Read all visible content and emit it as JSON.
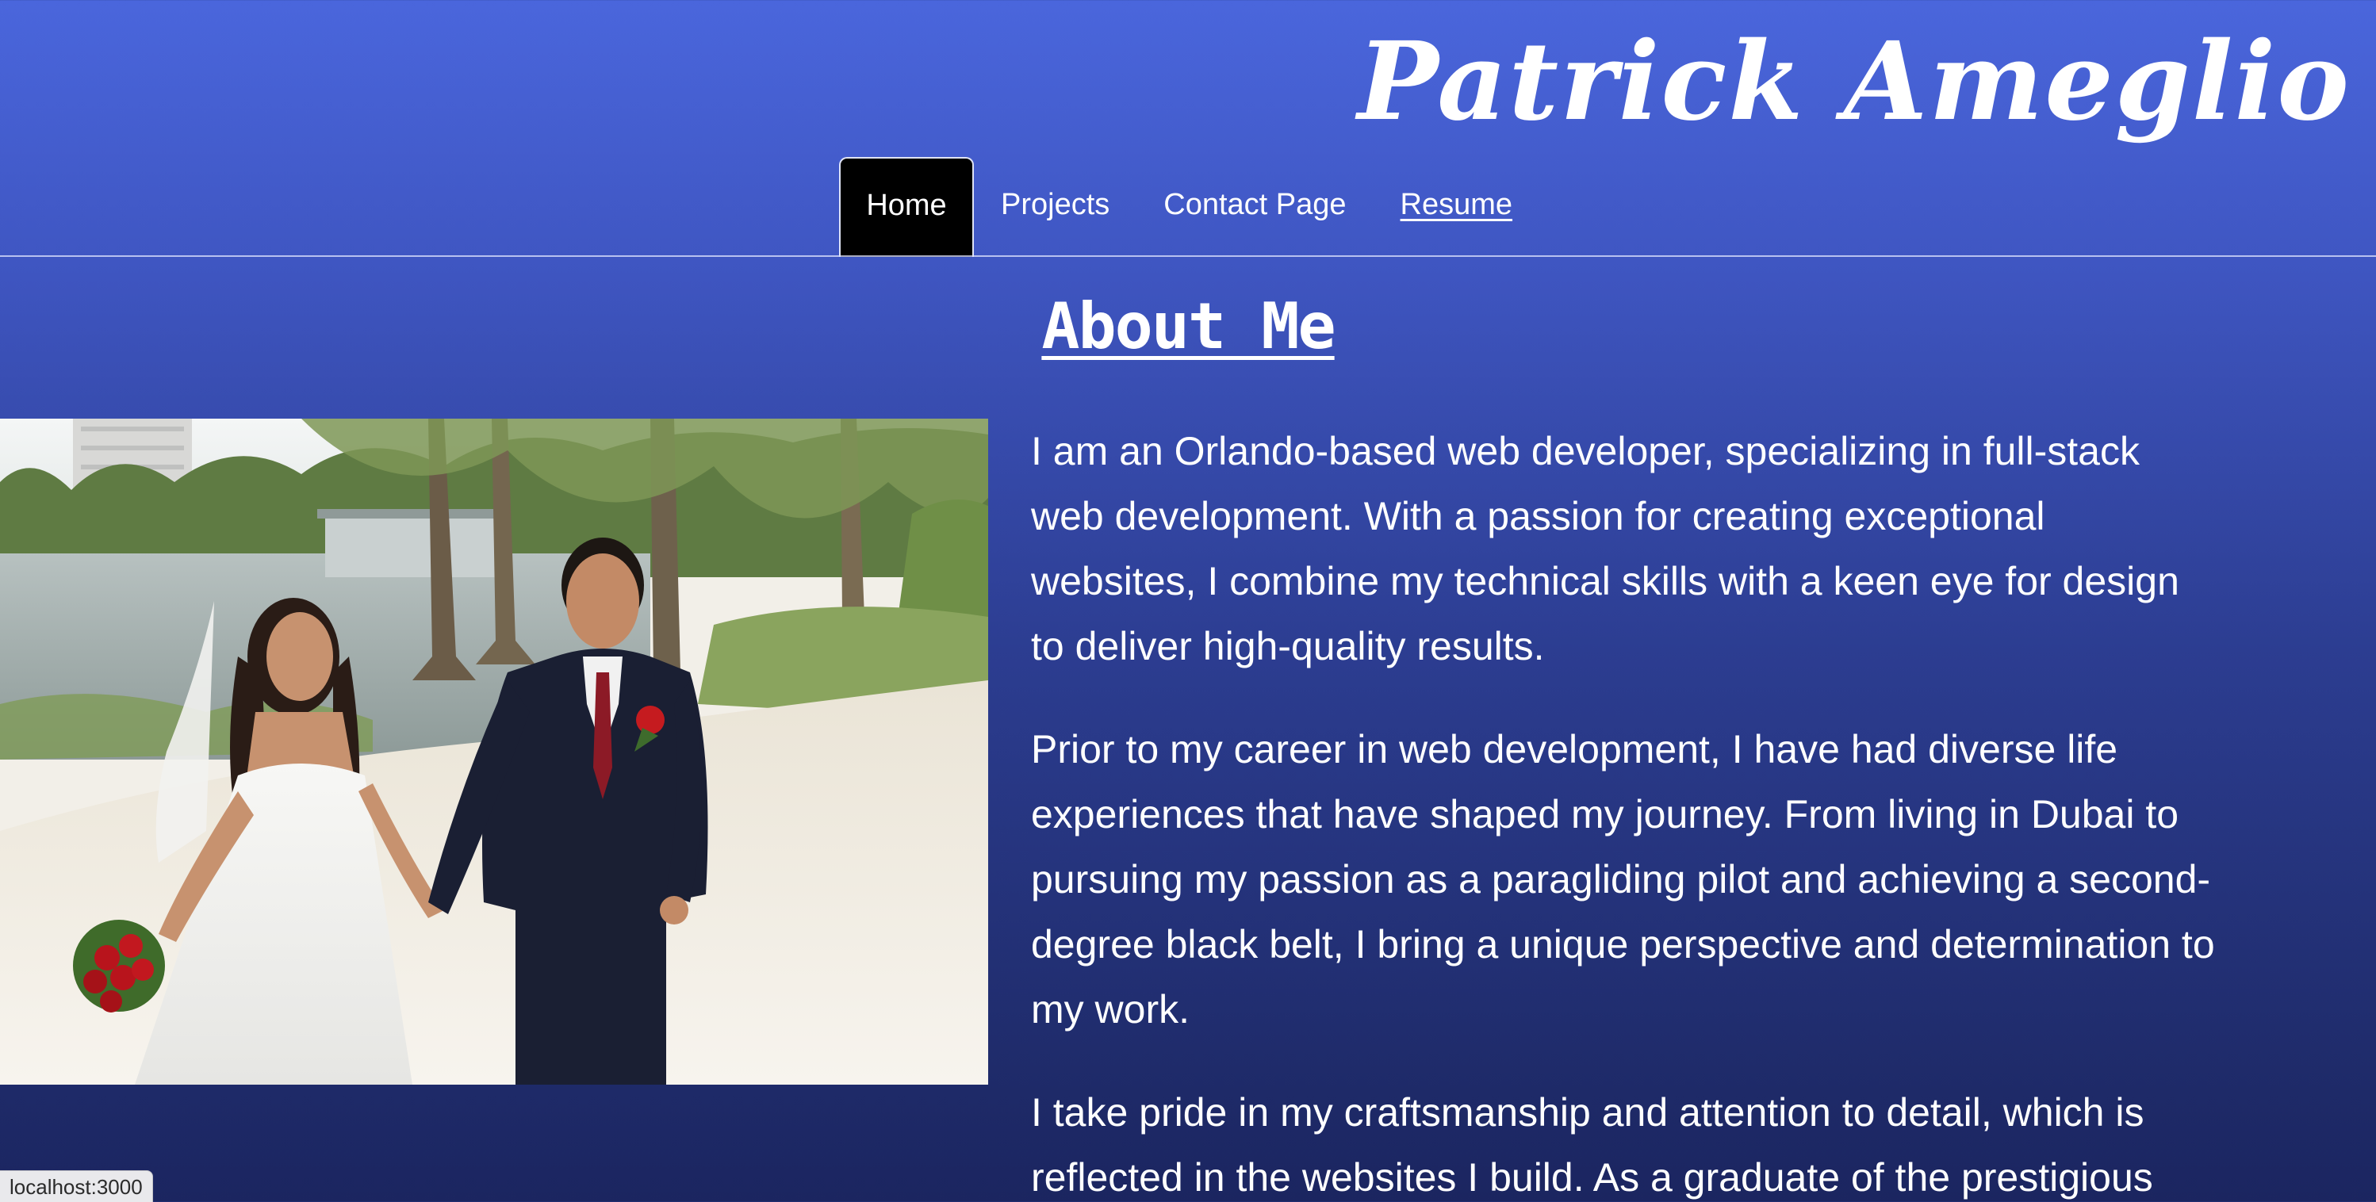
{
  "header": {
    "site_title": "Patrick Ameglio"
  },
  "nav": {
    "items": [
      {
        "label": "Home"
      },
      {
        "label": "Projects"
      },
      {
        "label": "Contact Page"
      },
      {
        "label": "Resume"
      }
    ],
    "active": "Home"
  },
  "about": {
    "heading": "About Me",
    "paragraphs": [
      "I am an Orlando-based web developer, specializing in full-stack web development. With a passion for creating exceptional websites, I combine my technical skills with a keen eye for design to deliver high-quality results.",
      "Prior to my career in web development, I have had diverse life experiences that have shaped my journey. From living in Dubai to pursuing my passion as a paragliding pilot and achieving a second-degree black belt, I bring a unique perspective and determination to my work.",
      "I take pride in my craftsmanship and attention to detail, which is reflected in the websites I build. As a graduate of the prestigious"
    ]
  },
  "status_bar": {
    "url": "localhost:3000"
  },
  "colors": {
    "header_gradient_top": "#4a66dc",
    "page_gradient_bottom": "#1b2560",
    "active_tab": "#000000",
    "text": "#ffffff"
  }
}
